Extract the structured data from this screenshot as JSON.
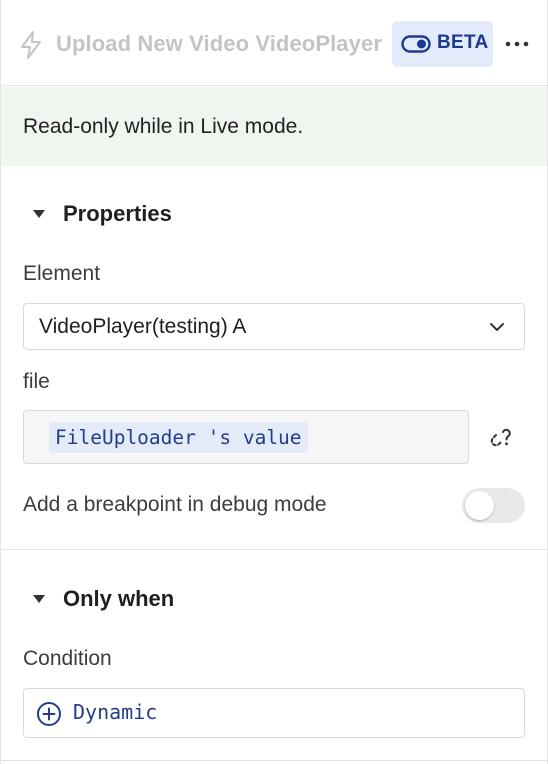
{
  "header": {
    "title": "Upload New Video VideoPlayer",
    "beta_label": "BETA",
    "icons": {
      "bolt": "bolt-icon",
      "toggle": "toggle-icon",
      "more": "more-horizontal-icon"
    }
  },
  "banner": {
    "text": "Read-only while in Live mode."
  },
  "properties": {
    "section_title": "Properties",
    "element_label": "Element",
    "element_value": "VideoPlayer(testing) A",
    "file_label": "file",
    "file_value": "FileUploader 's value",
    "breakpoint_label": "Add a breakpoint in debug mode",
    "breakpoint_enabled": false
  },
  "only_when": {
    "section_title": "Only when",
    "condition_label": "Condition",
    "dynamic_label": "Dynamic"
  },
  "colors": {
    "accent": "#233d8a",
    "beta_bg": "#e3ebfb",
    "banner_bg": "#eff5ef",
    "border": "#e4e4e4"
  }
}
